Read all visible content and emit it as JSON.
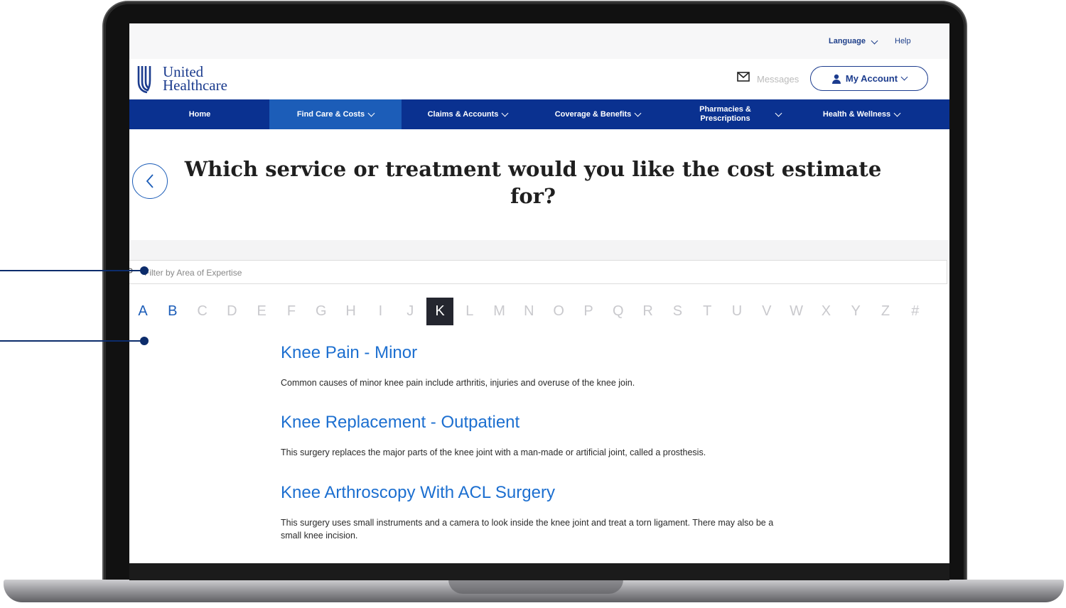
{
  "utility": {
    "language_label": "Language",
    "help_label": "Help"
  },
  "brand": {
    "line1": "United",
    "line2": "Healthcare"
  },
  "header": {
    "messages_label": "Messages",
    "account_label": "My Account"
  },
  "nav": {
    "items": [
      {
        "label": "Home"
      },
      {
        "label": "Find Care & Costs"
      },
      {
        "label": "Claims & Accounts"
      },
      {
        "label": "Coverage & Benefits"
      },
      {
        "label": "Pharmacies & Prescriptions"
      },
      {
        "label": "Health & Wellness"
      }
    ]
  },
  "page": {
    "title": "Which service or treatment would you like the cost estimate for?"
  },
  "filter": {
    "placeholder": "Filter by Area of Expertise"
  },
  "alphabet": {
    "letters": [
      "A",
      "B",
      "C",
      "D",
      "E",
      "F",
      "G",
      "H",
      "I",
      "J",
      "K",
      "L",
      "M",
      "N",
      "O",
      "P",
      "Q",
      "R",
      "S",
      "T",
      "U",
      "V",
      "W",
      "X",
      "Y",
      "Z",
      "#"
    ],
    "selected": "K",
    "linked": [
      "A",
      "B"
    ]
  },
  "results": [
    {
      "title": "Knee Pain - Minor",
      "description": "Common causes of minor knee pain include arthritis, injuries and overuse of the knee join."
    },
    {
      "title": "Knee Replacement - Outpatient",
      "description": "This surgery replaces the major parts of the knee joint with a man-made or artificial joint, called a prosthesis."
    },
    {
      "title": "Knee Arthroscopy With ACL Surgery",
      "description": "This surgery uses small instruments and a camera to look inside the knee joint and treat a torn ligament. There may also be a small knee incision."
    }
  ],
  "colors": {
    "brand_blue": "#1c3c8e",
    "nav_bg": "#0a3190",
    "nav_active": "#1c5db8",
    "link_blue": "#1c6fd0",
    "selected_letter_bg": "#24262f"
  }
}
